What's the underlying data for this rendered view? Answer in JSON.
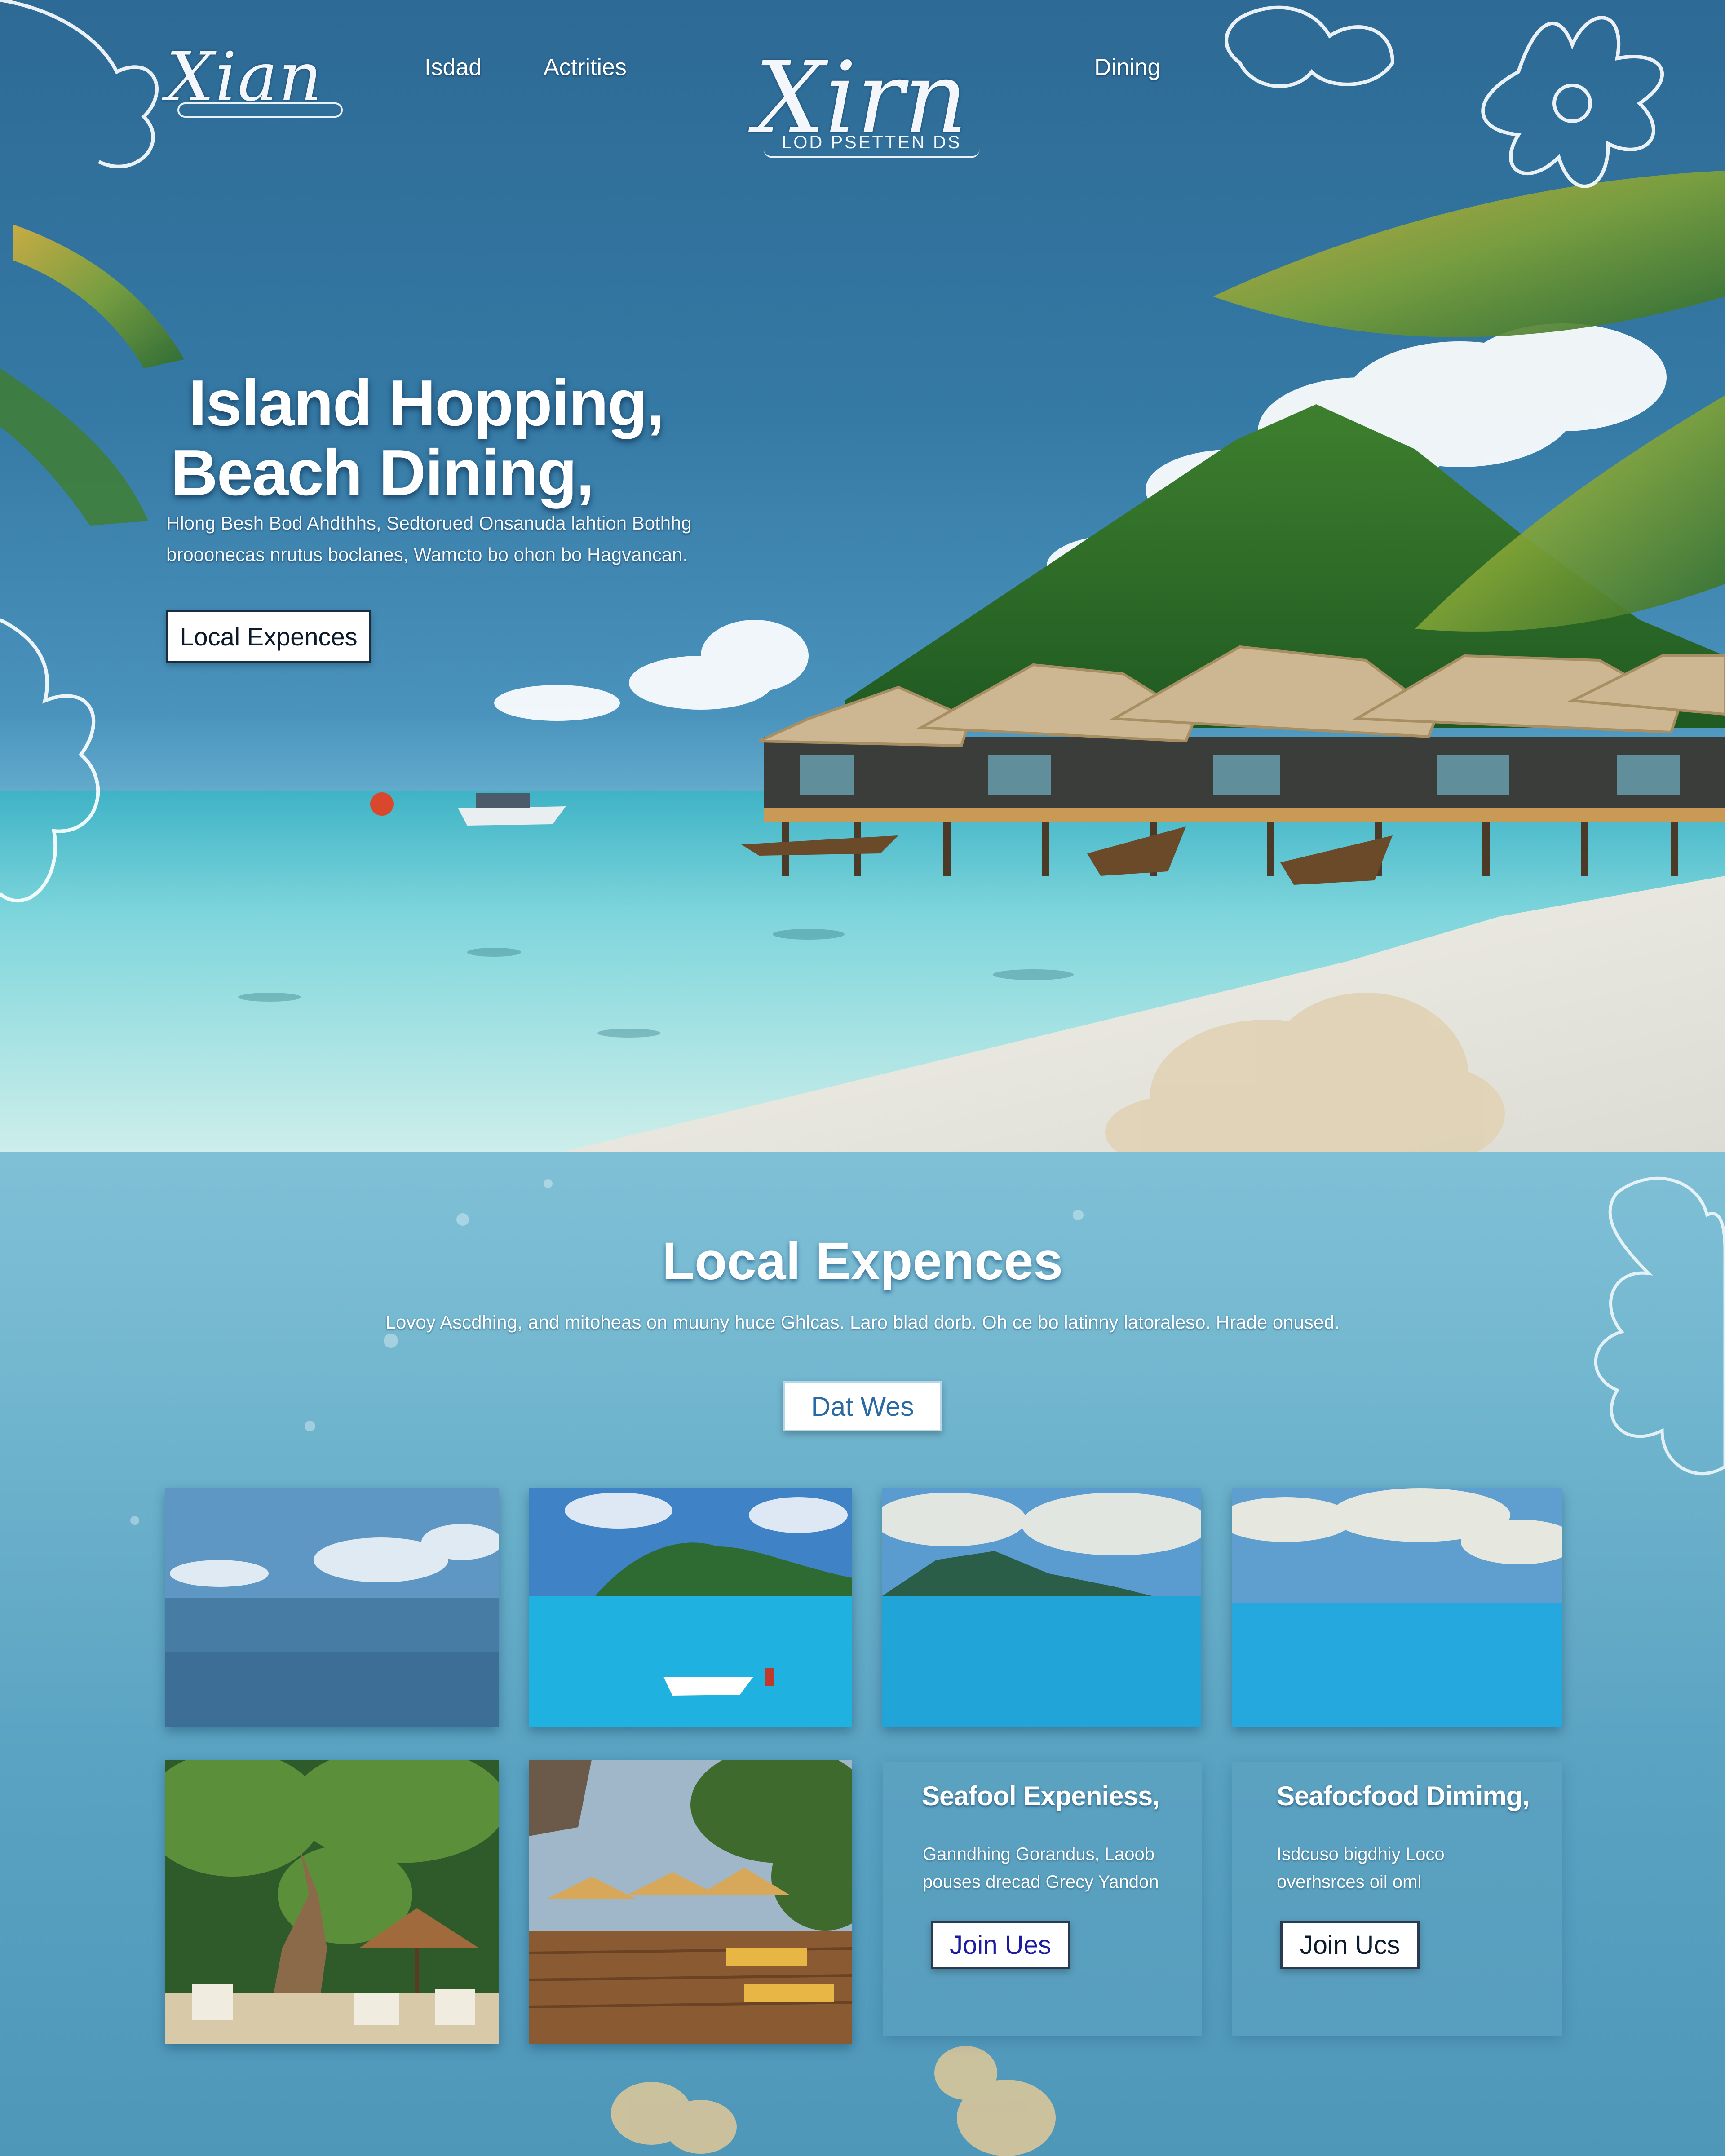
{
  "brand": {
    "logo_left": "Xian",
    "logo_center": "Xirn",
    "logo_center_tagline": "LOD PSETTEN DS"
  },
  "nav": {
    "items": [
      {
        "label": "Isdad"
      },
      {
        "label": "Actrities"
      },
      {
        "label": "Dining"
      }
    ]
  },
  "hero": {
    "title_line1": "Island Hopping,",
    "title_line2": "Beach Dining,",
    "description": "Hlong Besh Bod Ahdthhs, Sedtorued Onsanuda lahtion Bothhg brooonecas nrutus boclanes, Wamcto bo ohon bo Hagvancan.",
    "cta_label": "Local Expences"
  },
  "section": {
    "title": "Local Expences",
    "description": "Lovoy Ascdhing, and mitoheas on muuny huce Ghlcas. Laro blad dorb. Oh ce bo latinny latoraleso. Hrade onused.",
    "cta_label": "Dat Wes"
  },
  "gallery": [
    {
      "name": "open-sea-photo"
    },
    {
      "name": "island-boat-photo"
    },
    {
      "name": "island-horizon-photo"
    },
    {
      "name": "calm-sea-photo"
    },
    {
      "name": "garden-dining-photo"
    },
    {
      "name": "beach-deck-photo"
    }
  ],
  "cards": [
    {
      "title": "Seafool Expeniess,",
      "description": "Ganndhing Gorandus, Laoob pouses drecad Grecy Yandon",
      "button_label": "Join Ues"
    },
    {
      "title": "Seafocfood Dimimg,",
      "description": "Isdcuso bigdhiy Loco overhsrces oil oml",
      "button_label": "Join Ucs"
    }
  ],
  "colors": {
    "sky_top": "#2d6a95",
    "sea": "#7fd6dc",
    "section_bg": "#74b8d0",
    "button_border": "#1a2d40",
    "link_blue": "#2a6aa4"
  }
}
